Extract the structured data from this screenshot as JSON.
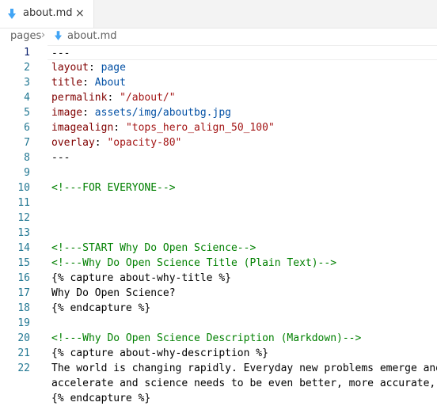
{
  "tab": {
    "title": "about.md",
    "close_label": "×"
  },
  "breadcrumb": {
    "folder": "pages",
    "separator": "›",
    "file": "about.md"
  },
  "editor": {
    "current_line": 1,
    "lines": [
      {
        "num": "1",
        "tokens": [
          {
            "t": "---",
            "c": "p"
          }
        ]
      },
      {
        "num": "2",
        "tokens": [
          {
            "t": "layout",
            "c": "k"
          },
          {
            "t": ": ",
            "c": "p"
          },
          {
            "t": "page",
            "c": "v"
          }
        ]
      },
      {
        "num": "3",
        "tokens": [
          {
            "t": "title",
            "c": "k"
          },
          {
            "t": ": ",
            "c": "p"
          },
          {
            "t": "About",
            "c": "v"
          }
        ]
      },
      {
        "num": "4",
        "tokens": [
          {
            "t": "permalink",
            "c": "k"
          },
          {
            "t": ": ",
            "c": "p"
          },
          {
            "t": "\"/about/\"",
            "c": "s"
          }
        ]
      },
      {
        "num": "5",
        "tokens": [
          {
            "t": "image",
            "c": "k"
          },
          {
            "t": ": ",
            "c": "p"
          },
          {
            "t": "assets/img/aboutbg.jpg",
            "c": "v"
          }
        ]
      },
      {
        "num": "6",
        "tokens": [
          {
            "t": "imagealign",
            "c": "k"
          },
          {
            "t": ": ",
            "c": "p"
          },
          {
            "t": "\"tops_hero_align_50_100\"",
            "c": "s"
          }
        ]
      },
      {
        "num": "7",
        "tokens": [
          {
            "t": "overlay",
            "c": "k"
          },
          {
            "t": ": ",
            "c": "p"
          },
          {
            "t": "\"opacity-80\"",
            "c": "s"
          }
        ]
      },
      {
        "num": "8",
        "tokens": [
          {
            "t": "---",
            "c": "p"
          }
        ]
      },
      {
        "num": "9",
        "tokens": []
      },
      {
        "num": "10",
        "tokens": [
          {
            "t": "<!---FOR EVERYONE-->",
            "c": "c"
          }
        ]
      },
      {
        "num": "11",
        "tokens": []
      },
      {
        "num": "12",
        "tokens": []
      },
      {
        "num": "13",
        "tokens": []
      },
      {
        "num": "14",
        "tokens": [
          {
            "t": "<!---START Why Do Open Science-->",
            "c": "c"
          }
        ]
      },
      {
        "num": "15",
        "tokens": [
          {
            "t": "<!---Why Do Open Science Title (Plain Text)-->",
            "c": "c"
          }
        ]
      },
      {
        "num": "16",
        "tokens": [
          {
            "t": "{% capture about-why-title %}",
            "c": "p"
          }
        ]
      },
      {
        "num": "17",
        "tokens": [
          {
            "t": "Why Do Open Science?",
            "c": "p"
          }
        ]
      },
      {
        "num": "18",
        "tokens": [
          {
            "t": "{% endcapture %}",
            "c": "p"
          }
        ]
      },
      {
        "num": "19",
        "tokens": []
      },
      {
        "num": "20",
        "tokens": [
          {
            "t": "<!---Why Do Open Science Description (Markdown)-->",
            "c": "c"
          }
        ]
      },
      {
        "num": "21",
        "tokens": [
          {
            "t": "{% capture about-why-description %}",
            "c": "p"
          }
        ]
      },
      {
        "num": "22",
        "tokens": [
          {
            "t": "The world is changing rapidly. Everyday new problems emerge and",
            "c": "p"
          }
        ]
      },
      {
        "num": "",
        "tokens": [
          {
            "t": "accelerate and science needs to be even better, more accurate, a",
            "c": "p"
          }
        ]
      },
      {
        "num": "",
        "tokens": [
          {
            "t": "{% endcapture %}",
            "c": "p"
          }
        ]
      }
    ]
  }
}
